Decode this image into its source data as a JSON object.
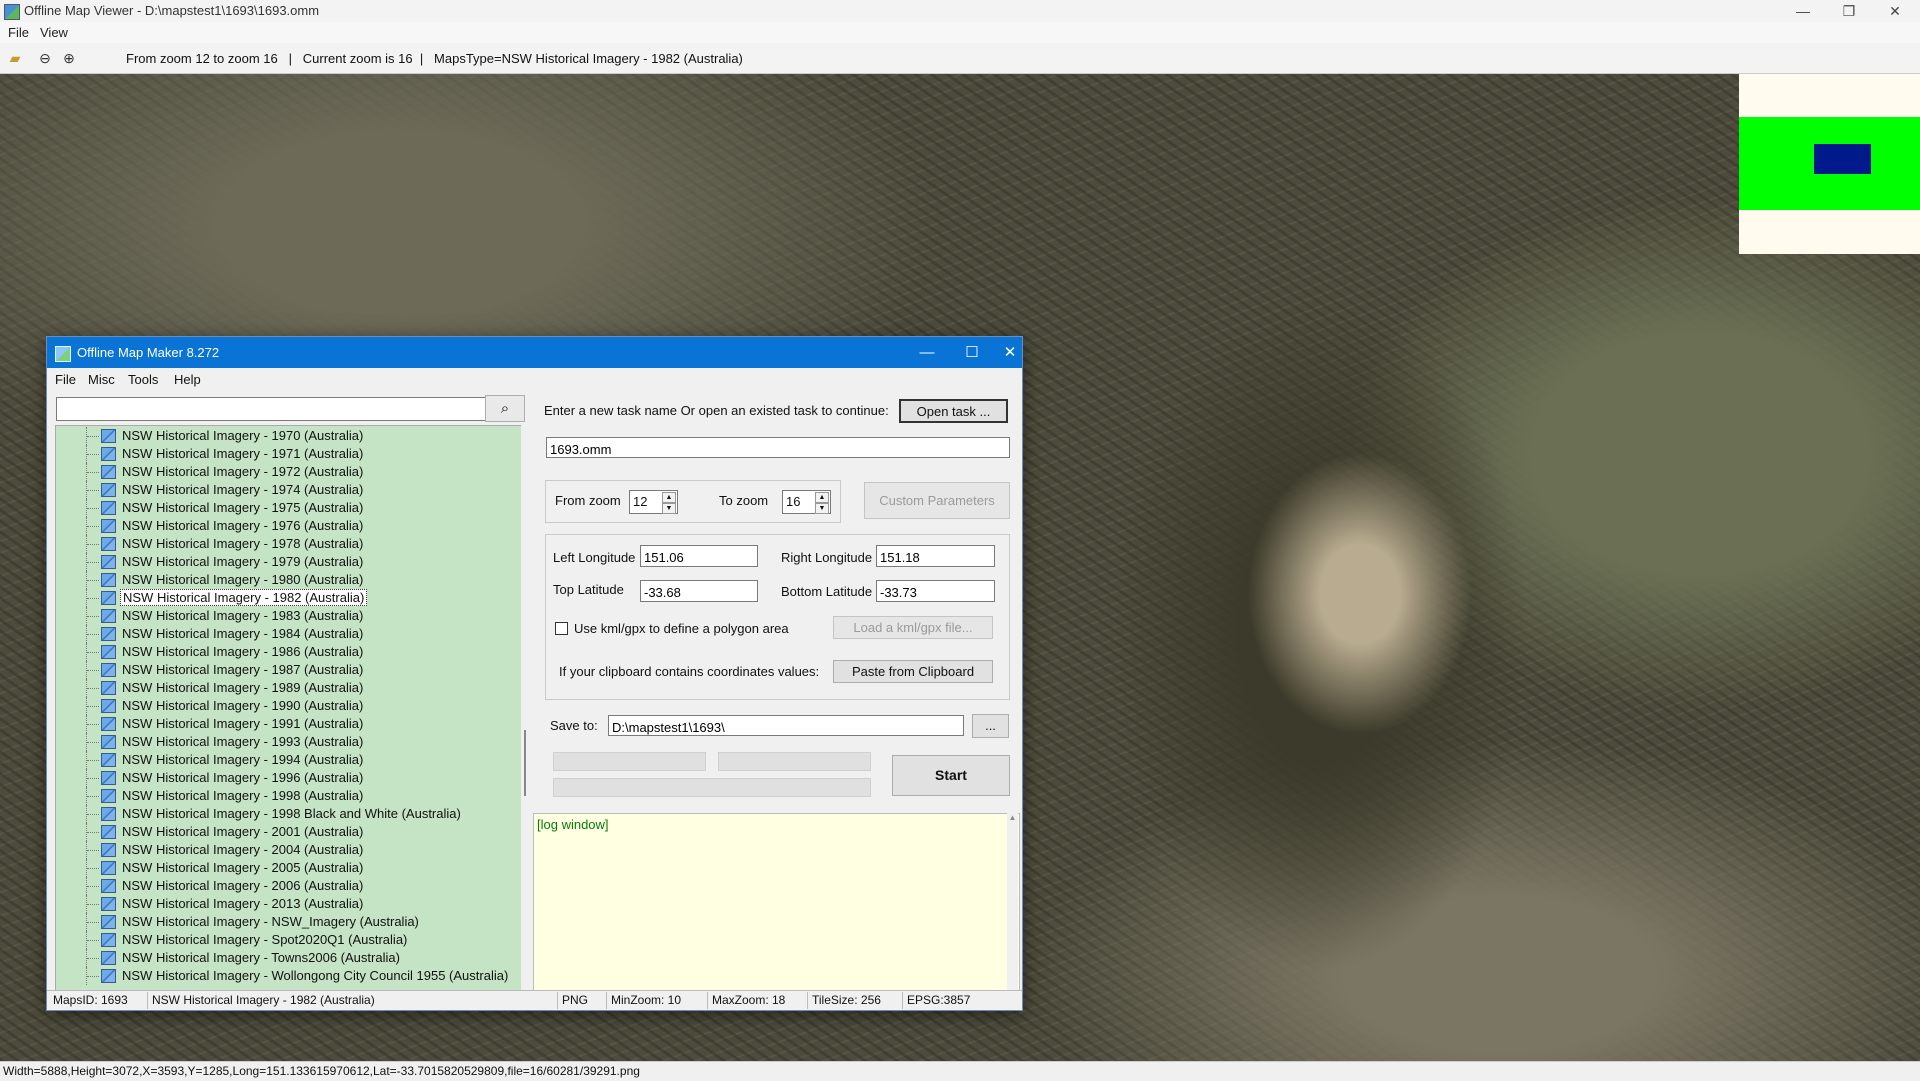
{
  "main": {
    "title": "Offline Map Viewer - D:\\mapstest1\\1693\\1693.omm",
    "menu": [
      "File",
      "View"
    ],
    "toolbar_info": "From zoom 12 to zoom 16   |   Current zoom is 16  |   MapsType=NSW Historical Imagery - 1982 (Australia)",
    "window_controls": {
      "minimize": "—",
      "restore": "❐",
      "close": "✕"
    },
    "status": "Width=5888,Height=3072,X=3593,Y=1285,Long=151.133615970612,Lat=-33.7015820529809,file=16/60281/39291.png",
    "icons": [
      "open-folder-icon",
      "zoom-out-icon",
      "zoom-in-icon"
    ],
    "overview_colors": {
      "frame": "#00ff00",
      "viewport": "#001a8c"
    }
  },
  "dialog": {
    "title": "Offline Map Maker 8.272",
    "menu": [
      "File",
      "Misc",
      "Tools",
      "Help"
    ],
    "window_controls": {
      "minimize": "—",
      "maximize": "☐",
      "close": "✕"
    },
    "search": {
      "value": "",
      "icon": "search-icon"
    },
    "tree_items": [
      "NSW Historical Imagery - 1970 (Australia)",
      "NSW Historical Imagery - 1971 (Australia)",
      "NSW Historical Imagery - 1972 (Australia)",
      "NSW Historical Imagery - 1974 (Australia)",
      "NSW Historical Imagery - 1975 (Australia)",
      "NSW Historical Imagery - 1976 (Australia)",
      "NSW Historical Imagery - 1978 (Australia)",
      "NSW Historical Imagery - 1979 (Australia)",
      "NSW Historical Imagery - 1980 (Australia)",
      "NSW Historical Imagery - 1982 (Australia)",
      "NSW Historical Imagery - 1983 (Australia)",
      "NSW Historical Imagery - 1984 (Australia)",
      "NSW Historical Imagery - 1986 (Australia)",
      "NSW Historical Imagery - 1987 (Australia)",
      "NSW Historical Imagery - 1989 (Australia)",
      "NSW Historical Imagery - 1990 (Australia)",
      "NSW Historical Imagery - 1991 (Australia)",
      "NSW Historical Imagery - 1993 (Australia)",
      "NSW Historical Imagery - 1994 (Australia)",
      "NSW Historical Imagery - 1996 (Australia)",
      "NSW Historical Imagery - 1998 (Australia)",
      "NSW Historical Imagery - 1998 Black and White (Australia)",
      "NSW Historical Imagery - 2001 (Australia)",
      "NSW Historical Imagery - 2004 (Australia)",
      "NSW Historical Imagery - 2005 (Australia)",
      "NSW Historical Imagery - 2006 (Australia)",
      "NSW Historical Imagery - 2013 (Australia)",
      "NSW Historical Imagery - NSW_Imagery (Australia)",
      "NSW Historical Imagery - Spot2020Q1 (Australia)",
      "NSW Historical Imagery - Towns2006 (Australia)",
      "NSW Historical Imagery - Wollongong City Council 1955 (Australia)"
    ],
    "selected_item": "NSW Historical Imagery - 1982 (Australia)",
    "task_prompt": "Enter a new task name Or open an existed task to continue:",
    "open_task_label": "Open task ...",
    "task_name": "1693.omm",
    "from_zoom_label": "From zoom",
    "from_zoom": "12",
    "to_zoom_label": "To zoom",
    "to_zoom": "16",
    "custom_params_label": "Custom Parameters",
    "left_lon_label": "Left Longitude",
    "left_lon": "151.06",
    "right_lon_label": "Right Longitude",
    "right_lon": "151.18",
    "top_lat_label": "Top Latitude",
    "top_lat": "-33.68",
    "bottom_lat_label": "Bottom Latitude",
    "bottom_lat": "-33.73",
    "kml_checkbox_label": "Use kml/gpx to define a polygon area",
    "load_kml_label": "Load a kml/gpx file...",
    "clipboard_prompt": "If your clipboard contains coordinates values:",
    "paste_label": "Paste from Clipboard",
    "save_to_label": "Save to:",
    "save_to": "D:\\mapstest1\\1693\\",
    "browse_label": "...",
    "start_label": "Start",
    "log_text": "[log window]",
    "status": {
      "maps_id": "MapsID: 1693",
      "maps_name": "NSW Historical Imagery - 1982 (Australia)",
      "format": "PNG",
      "min_zoom": "MinZoom: 10",
      "max_zoom": "MaxZoom: 18",
      "tile_size": "TileSize: 256",
      "epsg": "EPSG:3857"
    }
  }
}
